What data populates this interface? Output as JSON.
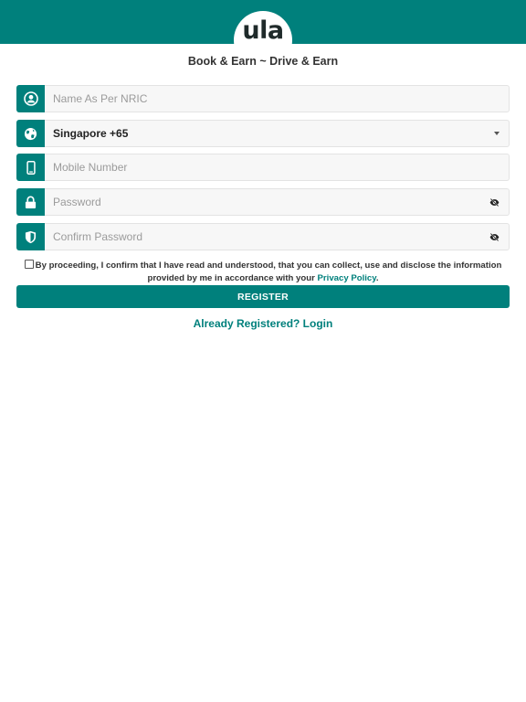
{
  "header": {
    "logo_text": "ula",
    "bg_color": "#00807c"
  },
  "tagline": "Book & Earn ~ Drive & Earn",
  "form": {
    "name": {
      "placeholder": "Name As Per NRIC",
      "icon": "user-icon"
    },
    "country": {
      "value": "Singapore +65",
      "icon": "globe-icon"
    },
    "mobile": {
      "placeholder": "Mobile Number",
      "icon": "phone-icon"
    },
    "password": {
      "placeholder": "Password",
      "icon": "lock-icon"
    },
    "confirm_password": {
      "placeholder": "Confirm Password",
      "icon": "shield-icon"
    }
  },
  "consent": {
    "text": "By proceeding, I confirm that I have read and understood, that you can collect, use and disclose the information provided by me in accordance with your ",
    "link": "Privacy Policy",
    "suffix": "."
  },
  "register_label": "REGISTER",
  "login_link": "Already Registered? Login"
}
